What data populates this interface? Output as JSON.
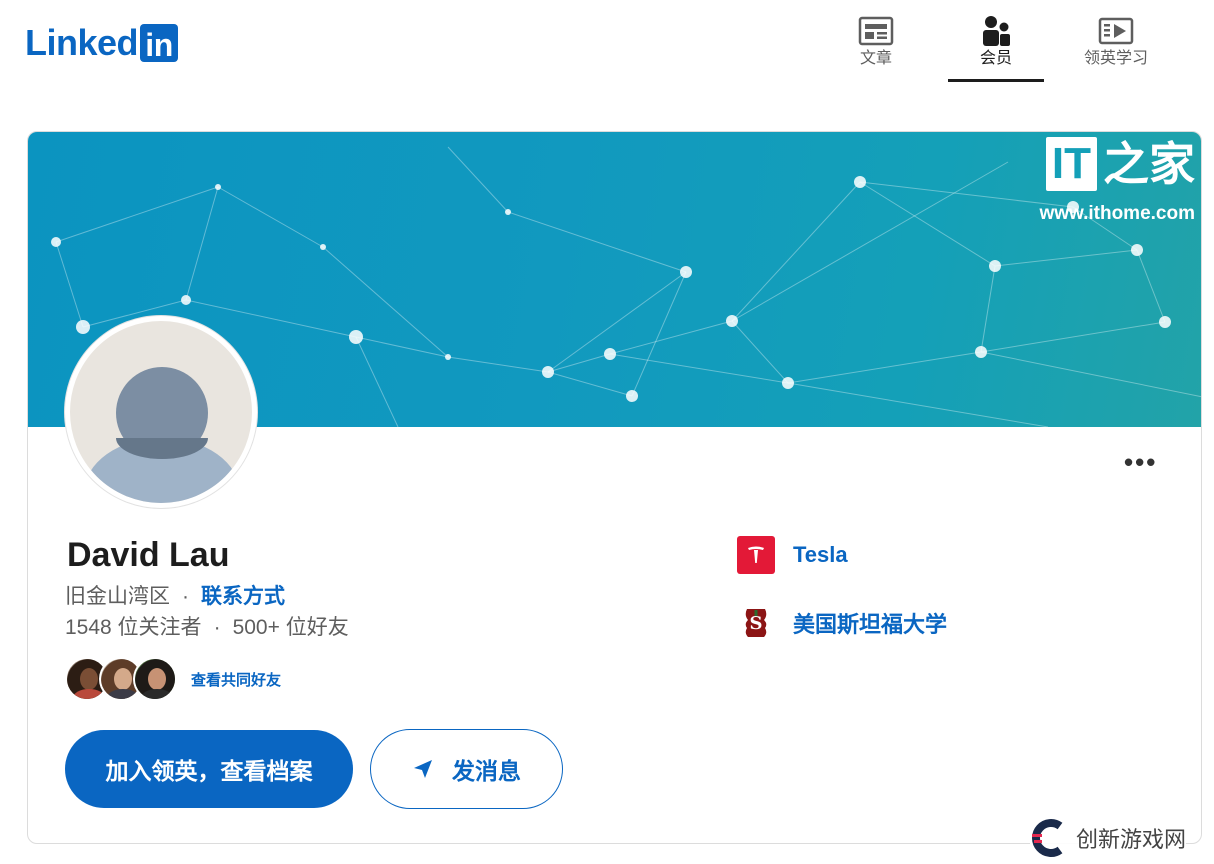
{
  "brand": {
    "logo_text": "Linked",
    "logo_box": "in",
    "color": "#0a66c2"
  },
  "nav": {
    "items": [
      {
        "label": "文章",
        "icon": "article-icon",
        "active": false
      },
      {
        "label": "会员",
        "icon": "people-icon",
        "active": true
      },
      {
        "label": "领英学习",
        "icon": "learning-video-icon",
        "active": false
      }
    ]
  },
  "banner": {
    "watermark_logo": "IT",
    "watermark_zh": "之家",
    "watermark_url": "www.ithome.com"
  },
  "profile": {
    "name": "David Lau",
    "location": "旧金山湾区",
    "contact_label": "联系方式",
    "followers": "1548 位关注者",
    "connections": "500+ 位好友",
    "mutual_label": "查看共同好友",
    "more_icon": "more-horizontal-icon"
  },
  "actions": {
    "join_label": "加入领英，查看档案",
    "message_label": "发消息"
  },
  "organizations": [
    {
      "name": "Tesla",
      "icon": "tesla-logo"
    },
    {
      "name": "美国斯坦福大学",
      "icon": "stanford-logo"
    }
  ],
  "corner_watermark": {
    "text": "创新游戏网"
  }
}
